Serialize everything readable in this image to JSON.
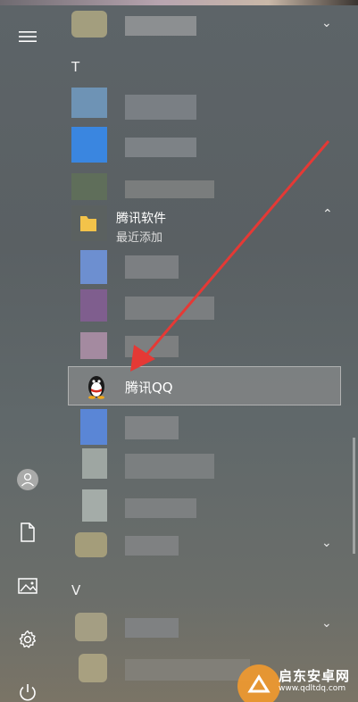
{
  "sections": {
    "t_letter": "T",
    "v_letter": "V"
  },
  "folder": {
    "title": "腾讯软件",
    "subtitle": "最近添加"
  },
  "app": {
    "label": "腾讯QQ"
  },
  "icons": {
    "menu": "hamburger-menu-icon",
    "user": "user-icon",
    "document": "document-icon",
    "pictures": "pictures-icon",
    "settings": "gear-icon",
    "power": "power-icon",
    "folder": "folder-icon",
    "qq": "qq-penguin-icon"
  },
  "watermark": {
    "text": "启东安卓网",
    "url": "www.qdltdq.com"
  },
  "colors": {
    "arrow": "#e53935",
    "folder": "#f3c34a"
  }
}
